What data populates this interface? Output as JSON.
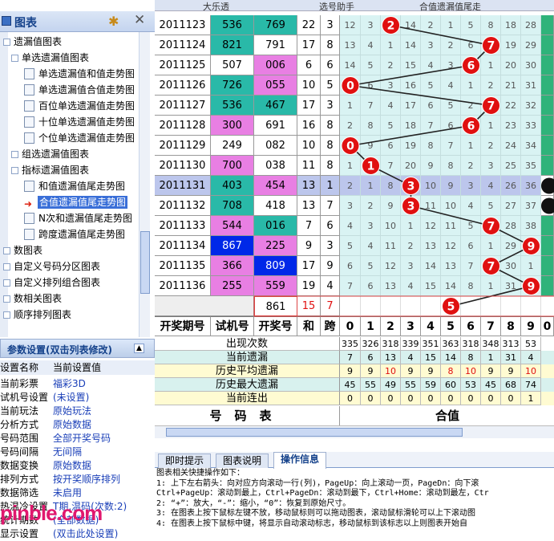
{
  "topbar": {
    "items": [
      "大乐透",
      "选号助手",
      "合值遗漏值尾走"
    ]
  },
  "tree": {
    "title": "图表",
    "items": [
      {
        "label": "遗漏值图表",
        "kind": "folder",
        "indent": 0
      },
      {
        "label": "单选遗漏值图表",
        "kind": "folder",
        "indent": 1
      },
      {
        "label": "单选遗漏值和值走势图",
        "kind": "doc",
        "indent": 2
      },
      {
        "label": "单选遗漏值合值走势图",
        "kind": "doc",
        "indent": 2
      },
      {
        "label": "百位单选遗漏值走势图",
        "kind": "doc",
        "indent": 2
      },
      {
        "label": "十位单选遗漏值走势图",
        "kind": "doc",
        "indent": 2
      },
      {
        "label": "个位单选遗漏值走势图",
        "kind": "doc",
        "indent": 2
      },
      {
        "label": "组选遗漏值图表",
        "kind": "folder",
        "indent": 1
      },
      {
        "label": "指标遗漏值图表",
        "kind": "folder",
        "indent": 1
      },
      {
        "label": "和值遗漏值尾走势图",
        "kind": "doc",
        "indent": 2
      },
      {
        "label": "合值遗漏值尾走势图",
        "kind": "selected",
        "indent": 2
      },
      {
        "label": "N次和遗漏值尾走势图",
        "kind": "doc",
        "indent": 2
      },
      {
        "label": "跨度遗漏值尾走势图",
        "kind": "doc",
        "indent": 2
      },
      {
        "label": "数图表",
        "kind": "folder",
        "indent": 0
      },
      {
        "label": "自定义号码分区图表",
        "kind": "folder",
        "indent": 0
      },
      {
        "label": "自定义排列组合图表",
        "kind": "folder",
        "indent": 0
      },
      {
        "label": "数相关图表",
        "kind": "folder",
        "indent": 0
      },
      {
        "label": "顺序排列图表",
        "kind": "folder",
        "indent": 0
      }
    ]
  },
  "params": {
    "title": "参数设置(双击列表修改)",
    "header": {
      "k": "设置名称",
      "v": "当前设置值"
    },
    "rows": [
      {
        "k": "当前彩票",
        "v": "福彩3D"
      },
      {
        "k": "试机号设置",
        "v": "(未设置)"
      },
      {
        "k": "当前玩法",
        "v": "原始玩法"
      },
      {
        "k": "分析方式",
        "v": "原始数据"
      },
      {
        "k": "号码范围",
        "v": "全部开奖号码"
      },
      {
        "k": "号码间隔",
        "v": "无间隔"
      },
      {
        "k": "数据变换",
        "v": "原始数据"
      },
      {
        "k": "排列方式",
        "v": "按开奖顺序排列"
      },
      {
        "k": "数据筛选",
        "v": "未启用"
      },
      {
        "k": "热温冷设置",
        "v": "T期,温码(次数:2)"
      },
      {
        "k": "统计期数",
        "v": "(全部数据)"
      },
      {
        "k": "显示设置",
        "v": "(双击此处设置)"
      }
    ]
  },
  "watermark": "pinble.com",
  "table": {
    "rows": [
      {
        "issue": "2011123",
        "test": "536",
        "draw": "769",
        "sum": "22",
        "span": "3",
        "hit": 2,
        "m": [
          "12",
          "3",
          "",
          "14",
          "2",
          "1",
          "5",
          "8",
          "18",
          "28"
        ]
      },
      {
        "issue": "2011124",
        "test": "821",
        "draw": "791",
        "sum": "17",
        "span": "8",
        "hit": 7,
        "m": [
          "13",
          "4",
          "1",
          "14",
          "3",
          "2",
          "6",
          "",
          "19",
          "29"
        ]
      },
      {
        "issue": "2011125",
        "test": "507",
        "draw": "006",
        "sum": "6",
        "span": "6",
        "hit": 6,
        "m": [
          "14",
          "5",
          "2",
          "15",
          "4",
          "3",
          "",
          "1",
          "20",
          "30"
        ]
      },
      {
        "issue": "2011126",
        "test": "726",
        "draw": "055",
        "sum": "10",
        "span": "5",
        "hit": 0,
        "m": [
          "",
          "6",
          "3",
          "16",
          "5",
          "4",
          "1",
          "2",
          "21",
          "31"
        ]
      },
      {
        "issue": "2011127",
        "test": "536",
        "draw": "467",
        "sum": "17",
        "span": "3",
        "hit": 7,
        "m": [
          "1",
          "7",
          "4",
          "17",
          "6",
          "5",
          "2",
          "",
          "22",
          "32"
        ]
      },
      {
        "issue": "2011128",
        "test": "300",
        "draw": "691",
        "sum": "16",
        "span": "8",
        "hit": 6,
        "m": [
          "2",
          "8",
          "5",
          "18",
          "7",
          "6",
          "",
          "1",
          "23",
          "33"
        ]
      },
      {
        "issue": "2011129",
        "test": "249",
        "draw": "082",
        "sum": "10",
        "span": "8",
        "hit": 0,
        "m": [
          "",
          "9",
          "6",
          "19",
          "8",
          "7",
          "1",
          "2",
          "24",
          "34"
        ]
      },
      {
        "issue": "2011130",
        "test": "700",
        "draw": "038",
        "sum": "11",
        "span": "8",
        "hit": 1,
        "m": [
          "1",
          "",
          "7",
          "20",
          "9",
          "8",
          "2",
          "3",
          "25",
          "35"
        ]
      },
      {
        "issue": "2011131",
        "test": "403",
        "draw": "454",
        "sum": "13",
        "span": "1",
        "hit": 3,
        "m": [
          "2",
          "1",
          "8",
          "",
          "10",
          "9",
          "3",
          "4",
          "26",
          "36"
        ]
      },
      {
        "issue": "2011132",
        "test": "708",
        "draw": "418",
        "sum": "13",
        "span": "7",
        "hit": 3,
        "m": [
          "3",
          "2",
          "9",
          "",
          "11",
          "10",
          "4",
          "5",
          "27",
          "37"
        ]
      },
      {
        "issue": "2011133",
        "test": "544",
        "draw": "016",
        "sum": "7",
        "span": "6",
        "hit": 7,
        "m": [
          "4",
          "3",
          "10",
          "1",
          "12",
          "11",
          "5",
          "",
          "28",
          "38"
        ]
      },
      {
        "issue": "2011134",
        "test": "867",
        "draw": "225",
        "sum": "9",
        "span": "3",
        "hit": 9,
        "m": [
          "5",
          "4",
          "11",
          "2",
          "13",
          "12",
          "6",
          "1",
          "29",
          ""
        ]
      },
      {
        "issue": "2011135",
        "test": "366",
        "draw": "809",
        "sum": "17",
        "span": "9",
        "hit": 7,
        "m": [
          "6",
          "5",
          "12",
          "3",
          "14",
          "13",
          "7",
          "",
          "30",
          "1"
        ]
      },
      {
        "issue": "2011136",
        "test": "255",
        "draw": "559",
        "sum": "19",
        "span": "4",
        "hit": 9,
        "m": [
          "7",
          "6",
          "13",
          "4",
          "15",
          "14",
          "8",
          "1",
          "31",
          ""
        ]
      }
    ],
    "predict": {
      "draw": "861",
      "sum": "15",
      "span": "7",
      "hit": 5
    },
    "headers": [
      "开奖期号",
      "试机号",
      "开奖号",
      "和",
      "跨",
      "0",
      "1",
      "2",
      "3",
      "4",
      "5",
      "6",
      "7",
      "8",
      "9",
      "0"
    ]
  },
  "stats": [
    {
      "label": "出现次数",
      "vals": [
        "335",
        "326",
        "318",
        "339",
        "351",
        "363",
        "318",
        "348",
        "313",
        "53"
      ],
      "bg": "#fff"
    },
    {
      "label": "当前遗漏",
      "vals": [
        "7",
        "6",
        "13",
        "4",
        "15",
        "14",
        "8",
        "1",
        "31",
        "4"
      ],
      "bg": "#d8f1ee"
    },
    {
      "label": "历史平均遗漏",
      "vals": [
        "9",
        "9",
        "10",
        "9",
        "9",
        "8",
        "10",
        "9",
        "9",
        "10"
      ],
      "bg": "#fffbd2"
    },
    {
      "label": "历史最大遗漏",
      "vals": [
        "45",
        "55",
        "49",
        "55",
        "59",
        "60",
        "53",
        "45",
        "68",
        "74"
      ],
      "bg": "#d8f1ee"
    },
    {
      "label": "当前连出",
      "vals": [
        "0",
        "0",
        "0",
        "0",
        "0",
        "0",
        "0",
        "0",
        "0",
        "1"
      ],
      "bg": "#fffbd2"
    }
  ],
  "footer": {
    "left": "号码表",
    "right": "合值"
  },
  "tabs": [
    "即时提示",
    "图表说明",
    "操作信息"
  ],
  "help": [
    "图表相关快捷操作如下：",
    "  1: 上下左右箭头：向对应方向滚动一行(列)，PageUp：向上滚动一页，PageDn：向下滚",
    "     Ctrl+PageUp：滚动到最上，Ctrl+PageDn：滚动到最下，Ctrl+Home：滚动到最左，Ctr",
    "  2: “+”：放大，“-”：缩小，“0”：恢复到原始尺寸。",
    "  3: 在图表上按下鼠标左键不放，移动鼠标则可以拖动图表，滚动鼠标滑轮可以上下滚动图",
    "  4: 在图表上按下鼠标中键，将显示自动滚动标志，移动鼠标到该标志以上则图表开始自"
  ],
  "colors": {
    "teal": "#29b9a8",
    "pink": "#e87fe3",
    "blue": "#0028e8",
    "red": "#e01010",
    "blueRow": "#bcc6ec",
    "cyanCell": "#d9f3f3",
    "green": "#2fb37a"
  }
}
